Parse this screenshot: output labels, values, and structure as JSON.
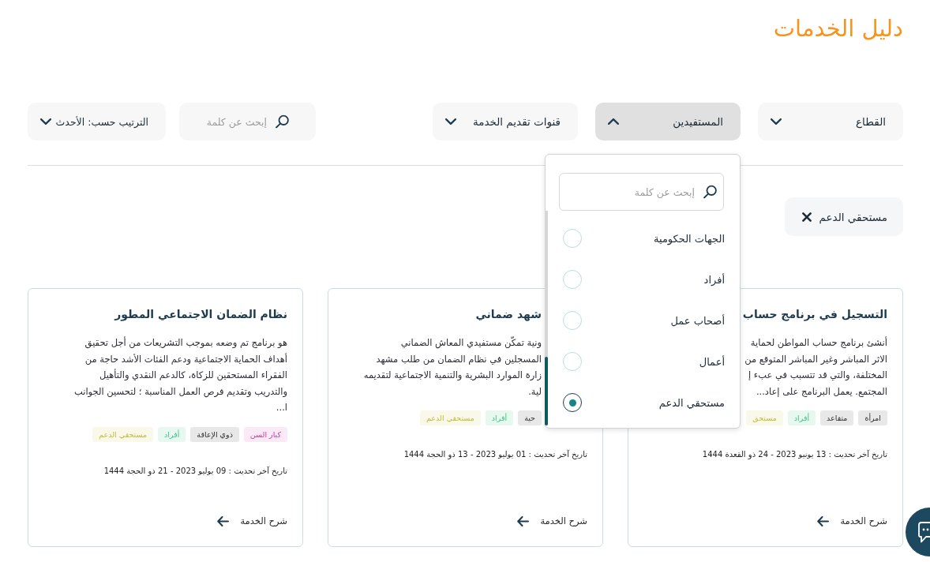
{
  "page_title": "دليل الخدمات",
  "filters": [
    {
      "label": "القطاع",
      "expanded": false
    },
    {
      "label": "المستفيدين",
      "expanded": true,
      "menu": {
        "search_placeholder": "إبحث عن كلمة",
        "options": [
          {
            "label": "الجهات الحكومية",
            "selected": false
          },
          {
            "label": "أفراد",
            "selected": false
          },
          {
            "label": "أصحاب عمل",
            "selected": false
          },
          {
            "label": "أعمال",
            "selected": false
          },
          {
            "label": "مستحقي الدعم",
            "selected": true
          }
        ]
      }
    },
    {
      "label": "قنوات تقديم الخدمة",
      "expanded": false
    }
  ],
  "search": {
    "placeholder": "إبحث عن كلمة"
  },
  "sort": {
    "label": "الترتيب حسب: الأحدث"
  },
  "active_filters": [
    {
      "label": "مستحقي الدعم"
    }
  ],
  "cards": [
    {
      "title": "التسجيل في برنامج حساب",
      "description_lines": [
        "أنشئ برنامج حساب المواطن لحماية",
        "الاثر المباشر وغير المباشر المتوقع من",
        "المختلفة، والتي قد تتسبب في عبء إ",
        "المجتمع. يعمل البرنامج على إعاد..."
      ],
      "tags": [
        {
          "label": "امرأة",
          "color": "#e8e8e8"
        },
        {
          "label": "متقاعد",
          "color": "#e8e8e8"
        },
        {
          "label": "أفراد",
          "color": "#e6f8ef"
        },
        {
          "label": "مستحق",
          "color": "#f9f8e9"
        }
      ],
      "updated": "تاريخ آخر تحديث : 13 يونيو 2023 - 24 ذو القعدة 1444",
      "link": "شرح الخدمة"
    },
    {
      "title": "شهد ضماني",
      "description_lines": [
        "ونية تمكّن مستفيدي المعاش الضماني",
        "المسجلين في نظام الضمان من طلب مشهد",
        "زارة الموارد البشرية والتنمية الاجتماعية لتقديمه",
        "لية."
      ],
      "tags": [
        {
          "label": "حية",
          "color": "#e8e8e8"
        },
        {
          "label": "أفراد",
          "color": "#e6f8ef"
        },
        {
          "label": "مستحقي الدعم",
          "color": "#f9f8e9"
        }
      ],
      "updated": "تاريخ آخر تحديث : 01 يوليو 2023 - 13 ذو الحجة 1444",
      "link": "شرح الخدمة"
    },
    {
      "title": "نظام الضمان الاجتماعي المطور",
      "description_lines": [
        "هو برنامج تم وضعه بموجب التشريعات من أجل تحقيق",
        "أهداف الحماية الاجتماعية ودعم الفئات الأشد حاجة من",
        "الفقراء المستحقين للزكاة، كالدعم النقدي والتأهيل",
        "والتدريب وتقديم فرص العمل المناسبة ؛ لتحسين الجوانب",
        "ا..."
      ],
      "tags": [
        {
          "label": "كبار السن",
          "color": "#fbe9f6"
        },
        {
          "label": "ذوي الإعاقة",
          "color": "#e8e8e8"
        },
        {
          "label": "أفراد",
          "color": "#e6f8ef"
        },
        {
          "label": "مستحقي الدعم",
          "color": "#f9f8e9"
        }
      ],
      "updated": "تاريخ آخر تحديث : 09 يوليو 2023 - 21 ذو الحجة 1444",
      "link": "شرح الخدمة"
    }
  ]
}
